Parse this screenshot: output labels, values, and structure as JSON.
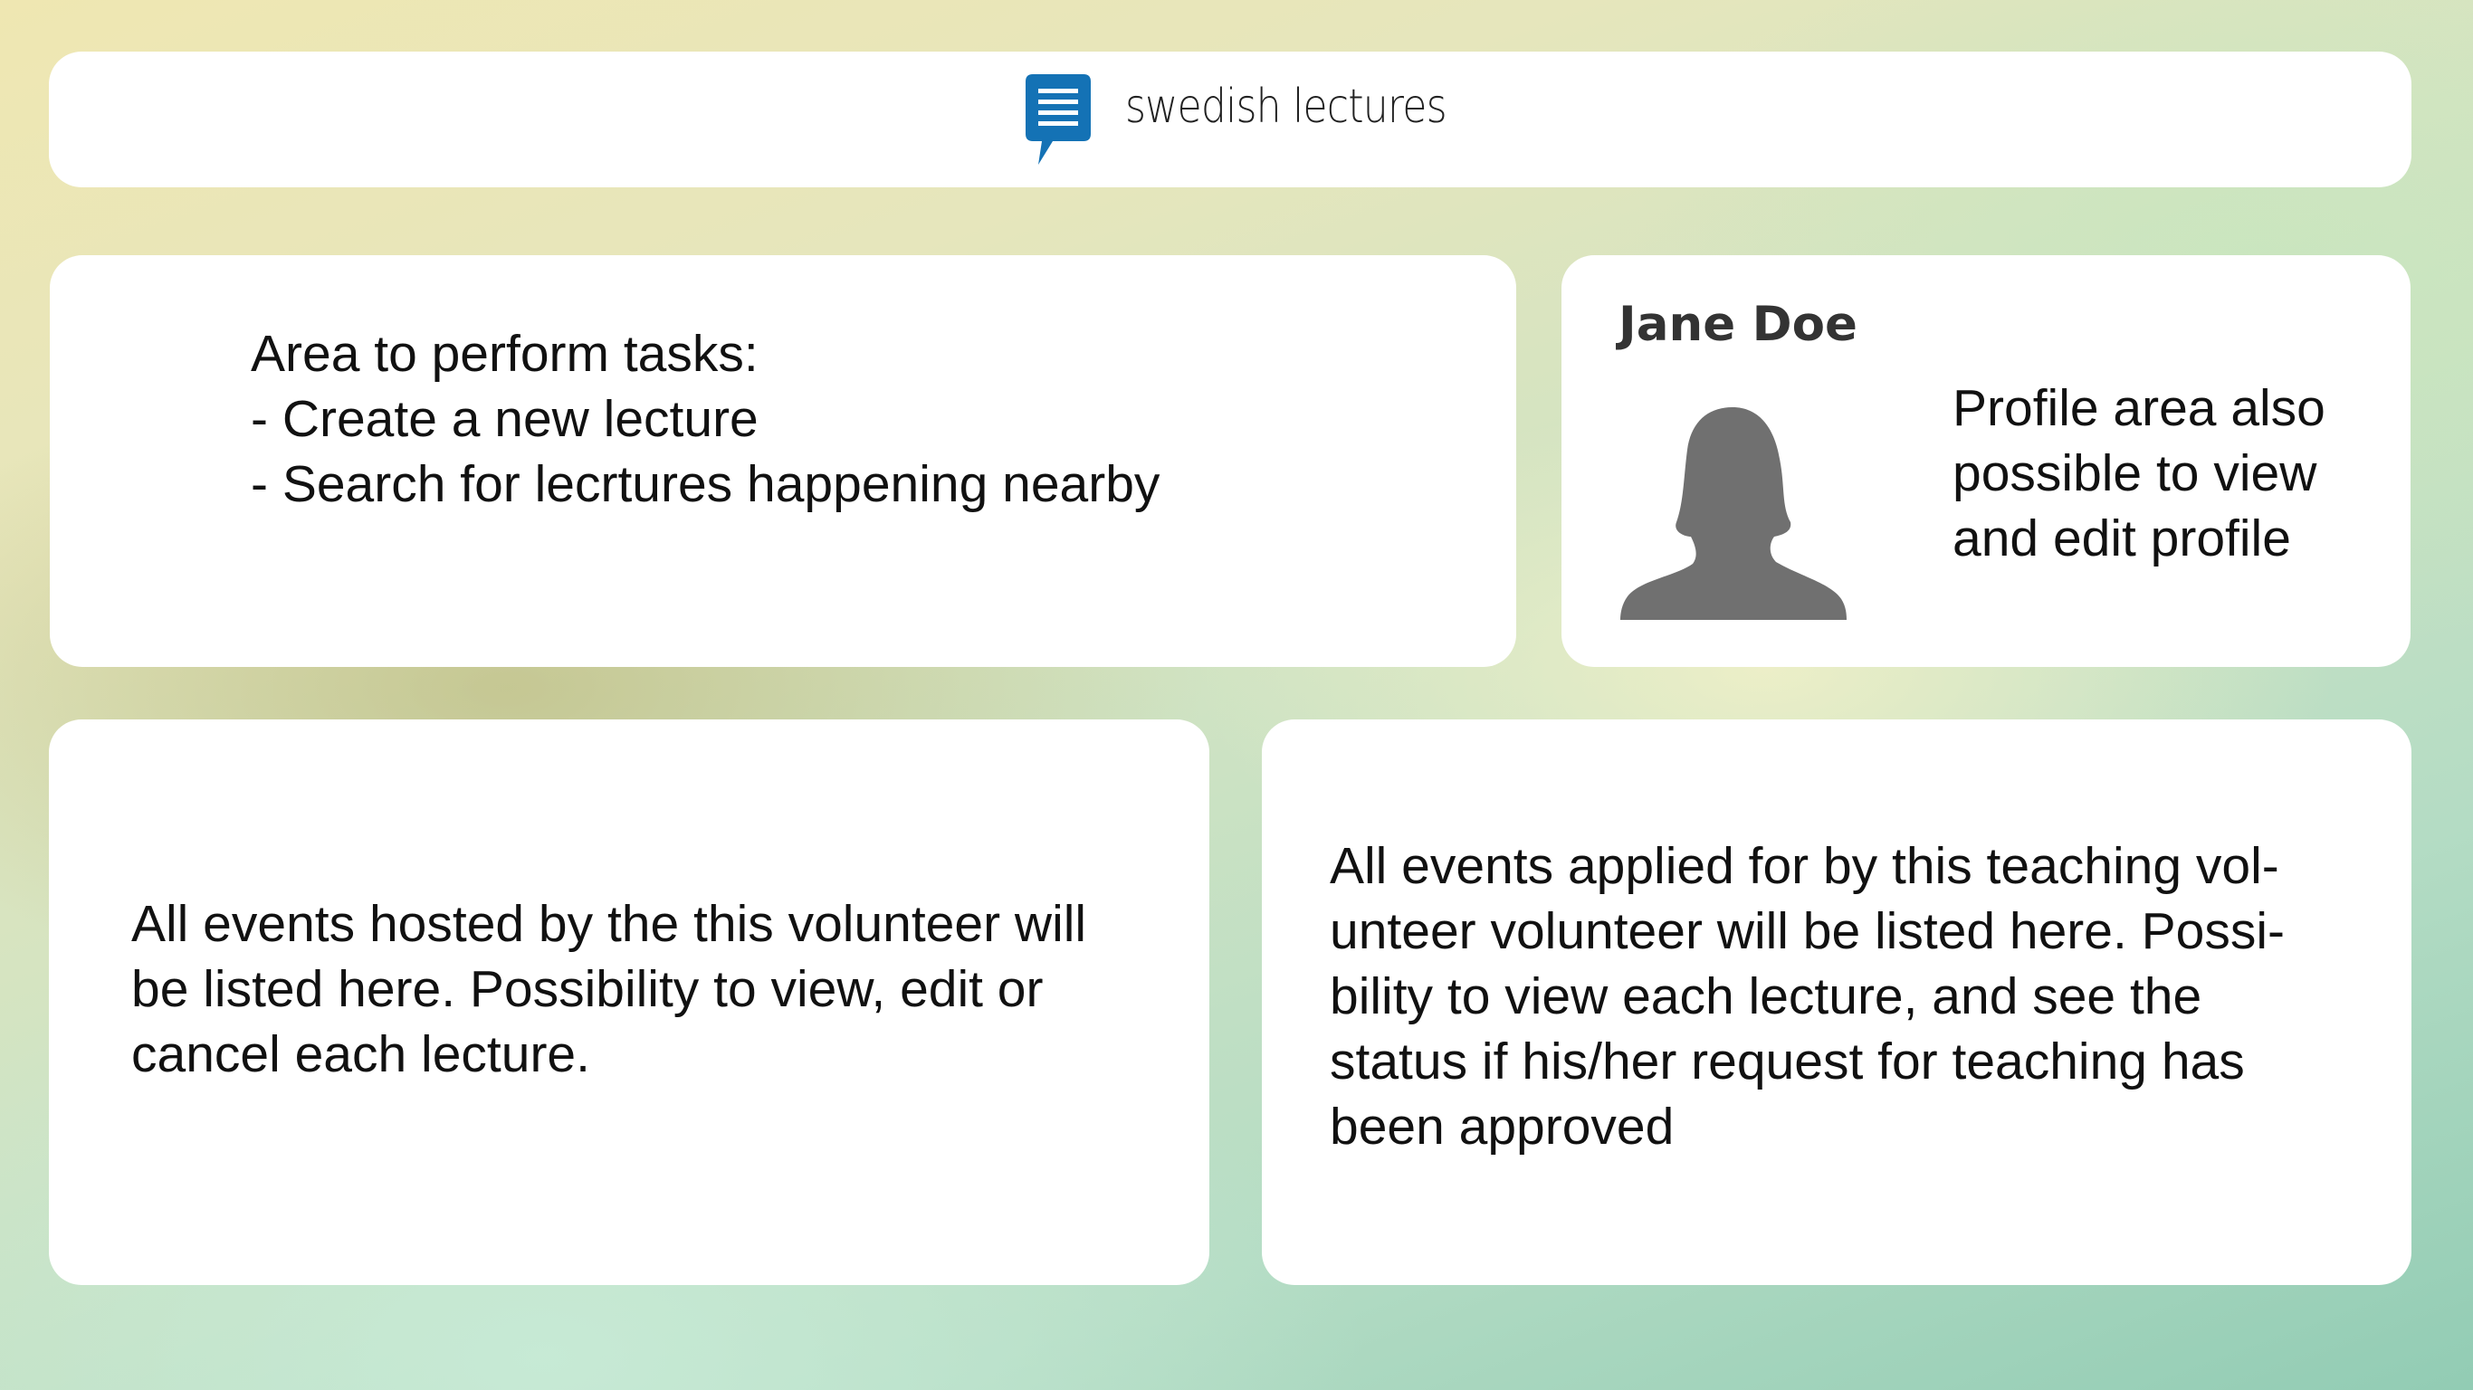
{
  "header": {
    "app_title": "swedish lectures",
    "logo_icon": "speech-bubble-document-icon",
    "logo_color": "#1472b5"
  },
  "tasks_panel": {
    "text": "Area to perform tasks:\n- Create a new lecture\n- Search for lecrtures happening nearby"
  },
  "profile_panel": {
    "name": "Jane Doe",
    "avatar_icon": "person-silhouette-icon",
    "description": "Profile area also\npossible to view\nand edit profile"
  },
  "hosted_events_panel": {
    "text": "All events hosted by the this volunteer will\nbe listed here. Possibility to view, edit or\ncancel each lecture."
  },
  "applied_events_panel": {
    "text": "All events applied for by this teaching vol-\nunteer volunteer will be listed here. Possi-\nbility to view each lecture, and see the\nstatus if his/her request for teaching has\nbeen approved"
  }
}
